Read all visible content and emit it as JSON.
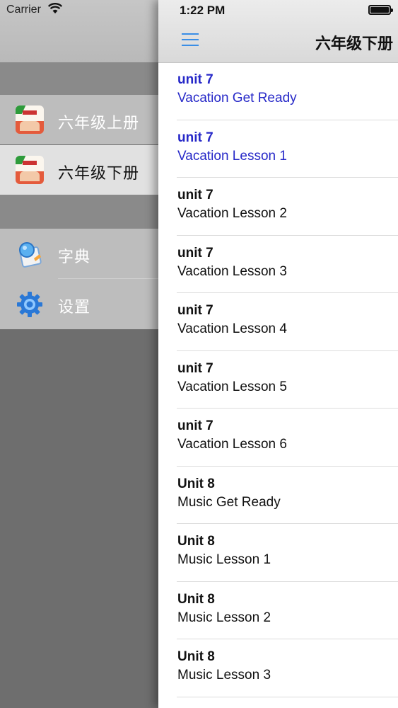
{
  "status_bar": {
    "carrier": "Carrier",
    "time": "1:22 PM"
  },
  "drawer": {
    "items": [
      {
        "label": "六年级上册",
        "icon": "textbook-icon",
        "selected": false
      },
      {
        "label": "六年级下册",
        "icon": "textbook-icon",
        "selected": true
      },
      {
        "label": "字典",
        "icon": "dictionary-icon",
        "selected": false
      },
      {
        "label": "设置",
        "icon": "gear-icon",
        "selected": false
      }
    ]
  },
  "navbar": {
    "title": "六年级下册",
    "menu_icon": "hamburger-menu-icon"
  },
  "lessons": [
    {
      "unit": "unit 7",
      "title": "Vacation Get Ready",
      "active": true
    },
    {
      "unit": "unit 7",
      "title": "Vacation Lesson 1",
      "active": true
    },
    {
      "unit": "unit 7",
      "title": "Vacation Lesson 2",
      "active": false
    },
    {
      "unit": "unit 7",
      "title": "Vacation Lesson 3",
      "active": false
    },
    {
      "unit": "unit 7",
      "title": "Vacation Lesson 4",
      "active": false
    },
    {
      "unit": "unit 7",
      "title": "Vacation Lesson 5",
      "active": false
    },
    {
      "unit": "unit 7",
      "title": "Vacation Lesson 6",
      "active": false
    },
    {
      "unit": "Unit 8",
      "title": "Music Get Ready",
      "active": false
    },
    {
      "unit": "Unit 8",
      "title": "Music Lesson 1",
      "active": false
    },
    {
      "unit": "Unit 8",
      "title": "Music Lesson 2",
      "active": false
    },
    {
      "unit": "Unit 8",
      "title": "Music Lesson 3",
      "active": false
    }
  ],
  "colors": {
    "accent": "#3a8ee6",
    "active_text": "#2628c8"
  }
}
